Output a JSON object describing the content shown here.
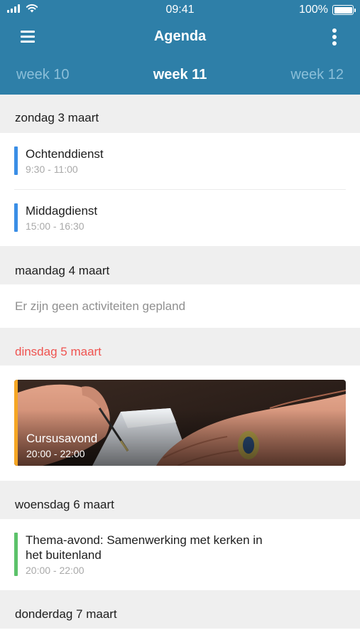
{
  "status_bar": {
    "time": "09:41",
    "battery": "100%"
  },
  "app_bar": {
    "title": "Agenda",
    "menu_icon": "hamburger-menu-icon",
    "more_icon": "vertical-dots-icon"
  },
  "weeks": {
    "previous": "week 10",
    "current": "week 11",
    "next": "week 12"
  },
  "colors": {
    "header": "#2e7fa8",
    "service_bar": "#3a8ee6",
    "course_bar": "#f5a623",
    "theme_bar": "#5cc26a",
    "today_text": "#ef5350"
  },
  "days": [
    {
      "label": "zondag 3 maart",
      "events": [
        {
          "title": "Ochtenddienst",
          "time": "9:30 - 11:00"
        },
        {
          "title": "Middagdienst",
          "time": "15:00 - 16:30"
        }
      ]
    },
    {
      "label": "maandag 4 maart",
      "empty_message": "Er zijn geen activiteiten gepland"
    },
    {
      "label": "dinsdag 5 maart",
      "events": [
        {
          "title": "Cursusavond",
          "time": "20:00 - 22:00"
        }
      ]
    },
    {
      "label": "woensdag 6 maart",
      "events": [
        {
          "title_line1": "Thema-avond: Samenwerking met kerken in",
          "title_line2": "het buitenland",
          "time": "20:00 - 22:00"
        }
      ]
    },
    {
      "label": "donderdag 7 maart"
    }
  ]
}
